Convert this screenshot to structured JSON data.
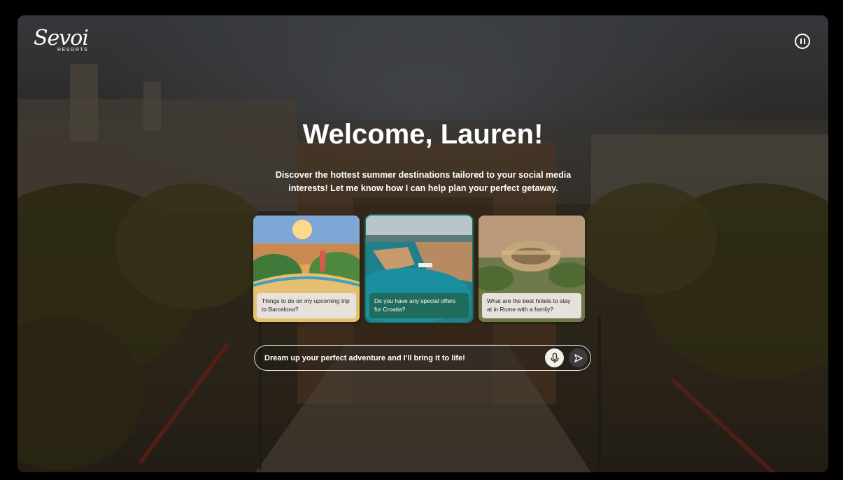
{
  "brand": {
    "logo_script": "Sevoi",
    "logo_sub": "RESORTS"
  },
  "header": {
    "pause_icon": "pause-circle-icon"
  },
  "hero": {
    "title": "Welcome, Lauren!",
    "subtitle": "Discover the hottest summer destinations tailored to your social media interests! Let me know how I can help plan your perfect getaway."
  },
  "cards": [
    {
      "caption": "Things to do on my upcoming trip to Barcelona?",
      "selected": false
    },
    {
      "caption": "Do you have any special offers for Croatia?",
      "selected": true
    },
    {
      "caption": "What are the best hotels to stay at in Rome with a family?",
      "selected": false
    }
  ],
  "prompt": {
    "placeholder": "Dream up your perfect adventure and I'll bring it to life!",
    "mic_icon": "microphone-icon",
    "send_icon": "send-icon"
  },
  "colors": {
    "accent": "#1f6b5c",
    "caption_bg": "#e7e1dc"
  }
}
